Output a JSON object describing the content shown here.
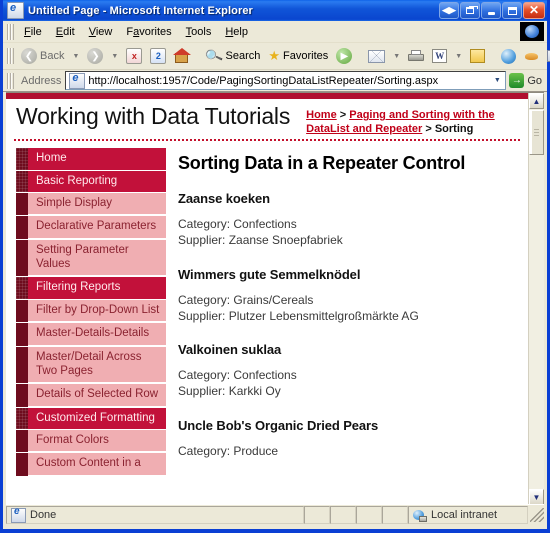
{
  "window": {
    "title": "Untitled Page - Microsoft Internet Explorer",
    "icon": "ie-page-icon",
    "buttons": {
      "restore_group": "restore-window-group",
      "restore_tab": "restore-tab",
      "minimize": "minimize",
      "maximize": "maximize",
      "close": "close"
    }
  },
  "menubar": {
    "items": [
      {
        "label": "File",
        "accel": "F"
      },
      {
        "label": "Edit",
        "accel": "E"
      },
      {
        "label": "View",
        "accel": "V"
      },
      {
        "label": "Favorites",
        "accel": "a"
      },
      {
        "label": "Tools",
        "accel": "T"
      },
      {
        "label": "Help",
        "accel": "H"
      }
    ]
  },
  "toolbar": {
    "back_label": "Back",
    "search_label": "Search",
    "favorites_label": "Favorites",
    "icons": [
      "back-icon",
      "back-dropdown-icon",
      "forward-icon",
      "forward-dropdown-icon",
      "stop-icon",
      "refresh-icon",
      "home-icon",
      "search-icon",
      "favorites-star-icon",
      "media-icon",
      "mail-icon",
      "mail-dropdown-icon",
      "print-icon",
      "edit-word-icon",
      "edit-dropdown-icon",
      "notes-icon",
      "messenger-globe-icon",
      "msn-icon",
      "edit-page-icon",
      "discuss-icon"
    ],
    "stop_glyph": "x",
    "refresh_glyph": "2",
    "word_glyph": "W"
  },
  "address": {
    "label": "Address",
    "url": "http://localhost:1957/Code/PagingSortingDataListRepeater/Sorting.aspx",
    "go_label": "Go",
    "go_glyph": "→",
    "dropdown_glyph": "▼"
  },
  "page": {
    "site_title": "Working with Data Tutorials",
    "breadcrumb": {
      "home": "Home",
      "sep1": ">",
      "section": "Paging and Sorting with the DataList and Repeater",
      "sep2": ">",
      "current": "Sorting"
    },
    "heading": "Sorting Data in a Repeater Control",
    "sidebar": [
      {
        "label": "Home",
        "level": "top"
      },
      {
        "label": "Basic Reporting",
        "level": "top"
      },
      {
        "label": "Simple Display",
        "level": "sub"
      },
      {
        "label": "Declarative Parameters",
        "level": "sub"
      },
      {
        "label": "Setting Parameter Values",
        "level": "sub"
      },
      {
        "label": "Filtering Reports",
        "level": "top"
      },
      {
        "label": "Filter by Drop-Down List",
        "level": "sub"
      },
      {
        "label": "Master-Details-Details",
        "level": "sub"
      },
      {
        "label": "Master/Detail Across Two Pages",
        "level": "sub"
      },
      {
        "label": "Details of Selected Row",
        "level": "sub"
      },
      {
        "label": "Customized Formatting",
        "level": "top"
      },
      {
        "label": "Format Colors",
        "level": "sub"
      },
      {
        "label": "Custom Content in a",
        "level": "sub"
      }
    ],
    "category_prefix": "Category: ",
    "supplier_prefix": "Supplier: ",
    "products": [
      {
        "name": "Zaanse koeken",
        "category": "Category: Confections",
        "supplier": "Supplier: Zaanse Snoepfabriek"
      },
      {
        "name": "Wimmers gute Semmelknödel",
        "category": "Category: Grains/Cereals",
        "supplier": "Supplier: Plutzer Lebensmittelgroßmärkte AG"
      },
      {
        "name": "Valkoinen suklaa",
        "category": "Category: Confections",
        "supplier": "Supplier: Karkki Oy"
      },
      {
        "name": "Uncle Bob's Organic Dried Pears",
        "category": "Category: Produce",
        "supplier": ""
      }
    ]
  },
  "scrollbar": {
    "up_glyph": "▲",
    "down_glyph": "▼"
  },
  "statusbar": {
    "status": "Done",
    "zone": "Local intranet"
  },
  "colors": {
    "brand_red": "#b01030",
    "nav_top": "#c2113a",
    "nav_stripe": "#6e0c1e",
    "nav_sub": "#f0aeb2",
    "link_red": "#c00018"
  }
}
